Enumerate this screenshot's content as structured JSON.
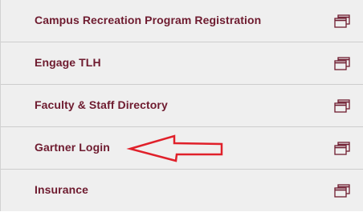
{
  "links": [
    {
      "label": "Campus Recreation Program Registration",
      "icon": "new-window-icon"
    },
    {
      "label": "Engage TLH",
      "icon": "new-window-icon"
    },
    {
      "label": "Faculty & Staff Directory",
      "icon": "new-window-icon"
    },
    {
      "label": "Gartner Login",
      "icon": "new-window-icon"
    },
    {
      "label": "Insurance",
      "icon": "new-window-icon"
    }
  ],
  "colors": {
    "link_text": "#6e1b2f",
    "background": "#efefef",
    "divider": "#cdcdcd",
    "icon": "#6e1b2f",
    "annotation_arrow": "#e0202a"
  },
  "annotation": {
    "type": "arrow",
    "points_to": "Gartner Login",
    "icon": "red-arrow-icon"
  }
}
